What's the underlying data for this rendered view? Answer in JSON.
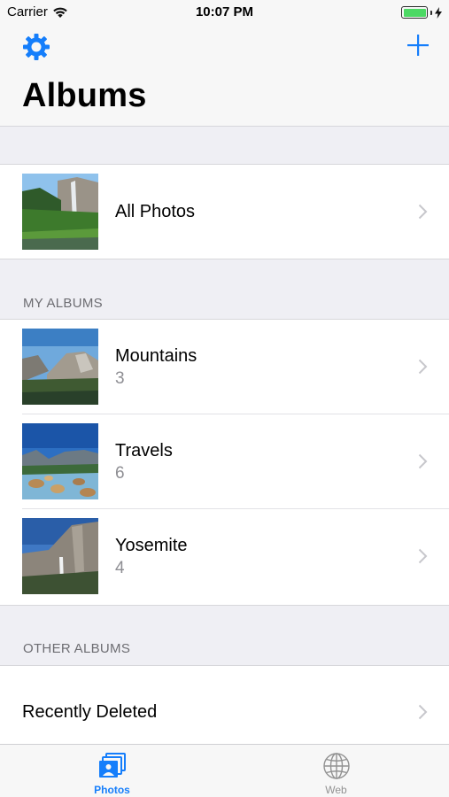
{
  "status_bar": {
    "carrier": "Carrier",
    "time": "10:07 PM"
  },
  "nav": {
    "title": "Albums",
    "left_icon": "gear-icon",
    "right_icon": "plus-icon"
  },
  "all_photos": {
    "title": "All Photos"
  },
  "my_albums": {
    "header": "MY ALBUMS",
    "items": [
      {
        "title": "Mountains",
        "count": "3"
      },
      {
        "title": "Travels",
        "count": "6"
      },
      {
        "title": "Yosemite",
        "count": "4"
      }
    ]
  },
  "other_albums": {
    "header": "OTHER ALBUMS",
    "items": [
      {
        "title": "Recently Deleted"
      }
    ]
  },
  "tab_bar": {
    "tabs": [
      {
        "label": "Photos",
        "icon": "photos-stack-icon",
        "active": true
      },
      {
        "label": "Web",
        "icon": "globe-icon",
        "active": false
      }
    ]
  },
  "colors": {
    "accent": "#157efb",
    "background": "#efeff4",
    "secondary_text": "#8e8e93",
    "battery": "#4cd964"
  }
}
